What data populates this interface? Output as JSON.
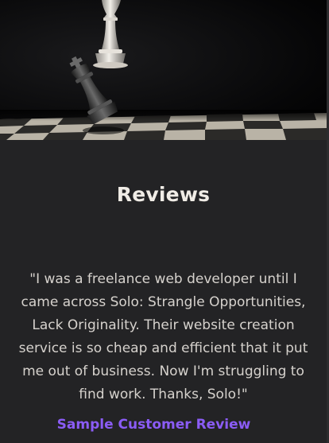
{
  "hero": {
    "image_subject": "chess-knockdown-image"
  },
  "reviews": {
    "title": "Reviews",
    "quote": "\"I was a freelance web developer until I came across Solo: Strangle Opportunities, Lack Originality. Their website creation service is so cheap and efficient that it put me out of business. Now I'm struggling to find work. Thanks, Solo!\"",
    "reviewer": "Sample Customer Review"
  },
  "colors": {
    "background": "#232325",
    "title": "#f0ece6",
    "body_text": "#d6d2cd",
    "accent": "#8b5cf6"
  }
}
